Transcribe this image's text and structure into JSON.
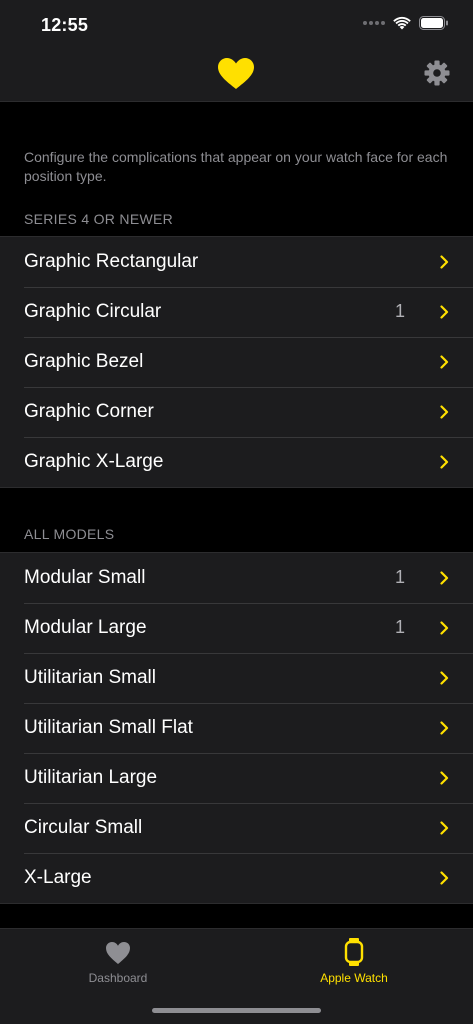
{
  "status_bar": {
    "time": "12:55"
  },
  "colors": {
    "accent": "#FFE000",
    "background": "#000000",
    "cell": "#1C1C1E",
    "secondary_text": "#8E8E93"
  },
  "nav": {
    "logo_icon": "heart-icon",
    "settings_icon": "gear-icon"
  },
  "intro": "Configure the complications that appear on your watch face for each position type.",
  "sections": [
    {
      "header": "SERIES 4 OR NEWER",
      "items": [
        {
          "label": "Graphic Rectangular",
          "count": ""
        },
        {
          "label": "Graphic Circular",
          "count": "1"
        },
        {
          "label": "Graphic Bezel",
          "count": ""
        },
        {
          "label": "Graphic Corner",
          "count": ""
        },
        {
          "label": "Graphic X-Large",
          "count": ""
        }
      ]
    },
    {
      "header": "ALL MODELS",
      "items": [
        {
          "label": "Modular Small",
          "count": "1"
        },
        {
          "label": "Modular Large",
          "count": "1"
        },
        {
          "label": "Utilitarian Small",
          "count": ""
        },
        {
          "label": "Utilitarian Small Flat",
          "count": ""
        },
        {
          "label": "Utilitarian Large",
          "count": ""
        },
        {
          "label": "Circular Small",
          "count": ""
        },
        {
          "label": "X-Large",
          "count": ""
        }
      ]
    }
  ],
  "tabs": [
    {
      "label": "Dashboard",
      "icon": "heart-icon",
      "selected": false
    },
    {
      "label": "Apple Watch",
      "icon": "watch-icon",
      "selected": true
    }
  ]
}
